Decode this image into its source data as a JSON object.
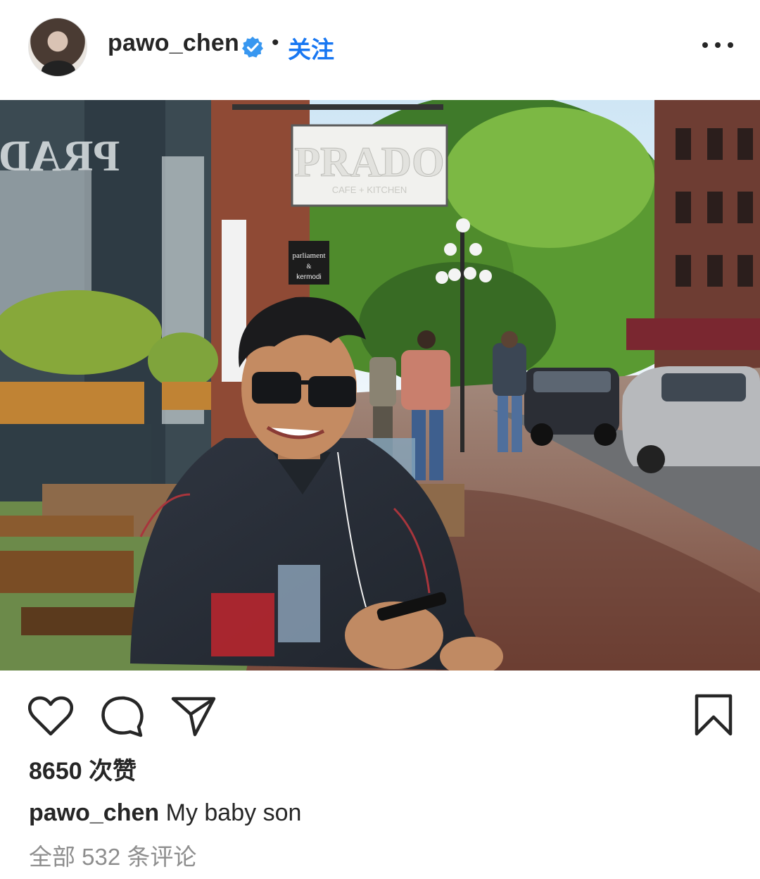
{
  "post": {
    "username": "pawo_chen",
    "follow_label": "关注",
    "separator": "•",
    "likes_text": "8650 次赞",
    "caption_text": "My baby son",
    "comments_text": "全部 532 条评论",
    "photo_sign_1": "PRADO",
    "photo_sign_1_sub": "CAFE + KITCHEN",
    "photo_sign_2_line1": "parliament",
    "photo_sign_2_line2": "&",
    "photo_sign_2_line3": "kermodi"
  },
  "icons": {
    "verified": "verified-badge-icon",
    "more": "more-options-icon",
    "like": "heart-icon",
    "comment": "comment-bubble-icon",
    "share": "paper-plane-icon",
    "save": "bookmark-icon"
  },
  "colors": {
    "accent": "#1877f2",
    "text": "#262626",
    "muted": "#8e8e8e"
  }
}
